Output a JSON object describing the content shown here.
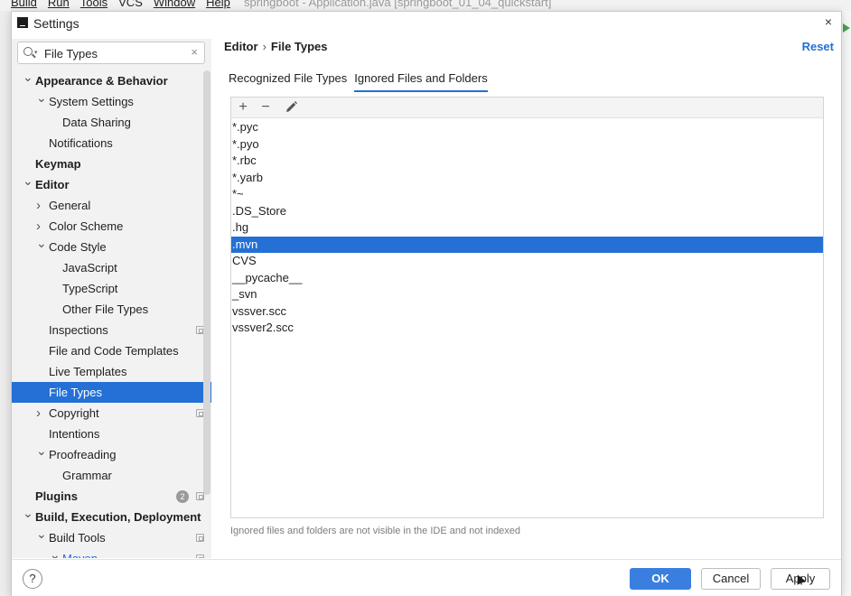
{
  "ide": {
    "menu": [
      "Build",
      "Run",
      "Tools",
      "VCS",
      "Window",
      "Help"
    ],
    "project_title": "springboot - Application.java [springboot_01_04_quickstart]"
  },
  "dialog": {
    "title": "Settings",
    "close_label": "×"
  },
  "search": {
    "value": "File Types",
    "clear_label": "×"
  },
  "sidebar": {
    "items": [
      {
        "label": "Appearance & Behavior",
        "level": 0,
        "arrow": "down",
        "bold": true
      },
      {
        "label": "System Settings",
        "level": 1,
        "arrow": "down"
      },
      {
        "label": "Data Sharing",
        "level": 2
      },
      {
        "label": "Notifications",
        "level": 1
      },
      {
        "label": "Keymap",
        "level": 0,
        "bold": true
      },
      {
        "label": "Editor",
        "level": 0,
        "arrow": "down",
        "bold": true
      },
      {
        "label": "General",
        "level": 1,
        "arrow": "right"
      },
      {
        "label": "Color Scheme",
        "level": 1,
        "arrow": "right"
      },
      {
        "label": "Code Style",
        "level": 1,
        "arrow": "down"
      },
      {
        "label": "JavaScript",
        "level": 2
      },
      {
        "label": "TypeScript",
        "level": 2
      },
      {
        "label": "Other File Types",
        "level": 2
      },
      {
        "label": "Inspections",
        "level": 1,
        "project": true
      },
      {
        "label": "File and Code Templates",
        "level": 1
      },
      {
        "label": "Live Templates",
        "level": 1
      },
      {
        "label": "File Types",
        "level": 1,
        "selected": true
      },
      {
        "label": "Copyright",
        "level": 1,
        "arrow": "right",
        "project": true
      },
      {
        "label": "Intentions",
        "level": 1
      },
      {
        "label": "Proofreading",
        "level": 1,
        "arrow": "down"
      },
      {
        "label": "Grammar",
        "level": 2
      },
      {
        "label": "Plugins",
        "level": 0,
        "bold": true,
        "badge": "2",
        "project": true
      },
      {
        "label": "Build, Execution, Deployment",
        "level": 0,
        "arrow": "down",
        "bold": true
      },
      {
        "label": "Build Tools",
        "level": 1,
        "arrow": "down",
        "project": true
      },
      {
        "label": "Maven",
        "level": 2,
        "arrow": "down",
        "link": true,
        "project": true
      }
    ]
  },
  "content": {
    "breadcrumb": {
      "parent": "Editor",
      "separator": "›",
      "current": "File Types"
    },
    "reset_label": "Reset",
    "tabs": [
      {
        "label": "Recognized File Types",
        "active": false
      },
      {
        "label": "Ignored Files and Folders",
        "active": true
      }
    ],
    "toolbar": {
      "add": "+",
      "remove": "−"
    },
    "ignored_items": [
      "*.pyc",
      "*.pyo",
      "*.rbc",
      "*.yarb",
      "*~",
      ".DS_Store",
      ".hg",
      ".mvn",
      "CVS",
      "__pycache__",
      "_svn",
      "vssver.scc",
      "vssver2.scc"
    ],
    "selected_item": ".mvn",
    "hint": "Ignored files and folders are not visible in the IDE and not indexed"
  },
  "footer": {
    "help": "?",
    "ok": "OK",
    "cancel": "Cancel",
    "apply": "Apply"
  },
  "colors": {
    "accent": "#2470d6",
    "ok_button": "#3a7fdf",
    "sidebar_bg": "#f2f2f2"
  }
}
